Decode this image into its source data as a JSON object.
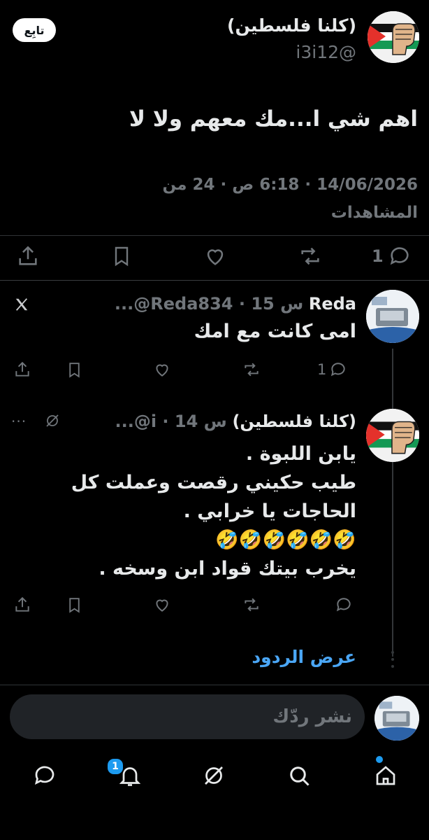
{
  "main_tweet": {
    "display_name": "(كلنا فلسطين)",
    "handle": "@i3i12",
    "follow_label": "تابِع",
    "text": "اهم شي ا...مك معهم ولا لا",
    "meta_line1": "14/06/2026 · 6:18 ص · 24 من",
    "meta_line2": "المشاهدات",
    "reply_count": "1"
  },
  "reply1": {
    "display_name": "Reda",
    "header_rest": "...@Reda834 · 15 س",
    "text": "امى كانت مع امك",
    "reply_count": "1"
  },
  "reply2": {
    "display_name": "(كلنا فلسطين)",
    "header_rest": "...@i · 14 س",
    "lines": [
      "يابن اللبوة .",
      "طيب حكيني رقصت وعملت كل",
      "الحاجات يا خرابي .",
      "🤣🤣🤣🤣🤣🤣",
      "يخرب بيتك قواد ابن وسخه ."
    ]
  },
  "show_replies_label": "عرض الردود",
  "composer": {
    "placeholder": "نشر ردّك"
  },
  "nav": {
    "notifications_badge": "1"
  },
  "colors": {
    "accent": "#1d9bf0",
    "link": "#4aa6f5",
    "muted": "#71767b",
    "divider": "#2f3336"
  }
}
